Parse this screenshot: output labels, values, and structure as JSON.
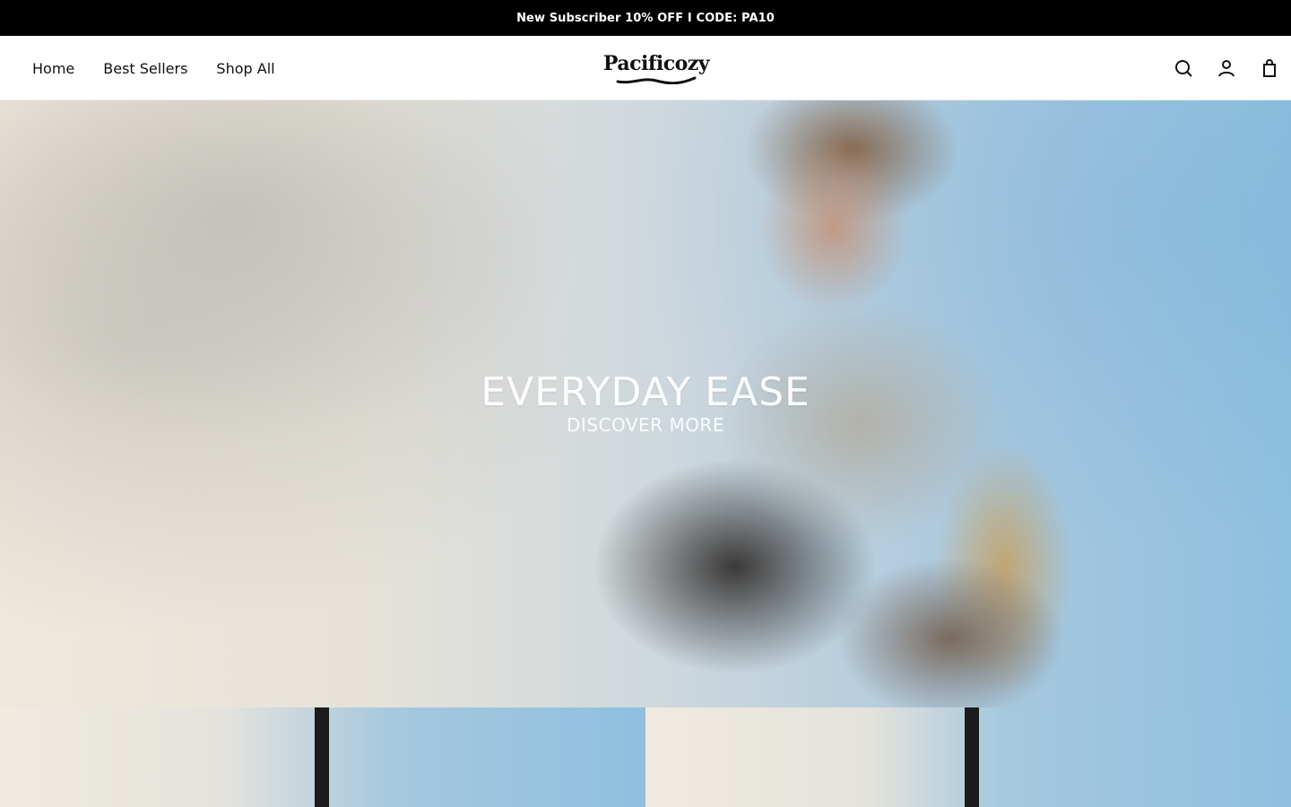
{
  "announcement": {
    "text": "New Subscriber 10% OFF I CODE: PA10"
  },
  "header": {
    "nav": [
      {
        "label": "Home"
      },
      {
        "label": "Best Sellers"
      },
      {
        "label": "Shop All"
      }
    ],
    "logo_text": "Pacificozy",
    "icons": [
      "search-icon",
      "account-icon",
      "bag-icon"
    ]
  },
  "hero": {
    "title": "EVERYDAY  EASE",
    "cta": "DISCOVER MORE"
  },
  "colors": {
    "announcement_bg": "#000000",
    "announcement_text": "#ffffff",
    "header_bg": "#ffffff",
    "text": "#111111"
  }
}
